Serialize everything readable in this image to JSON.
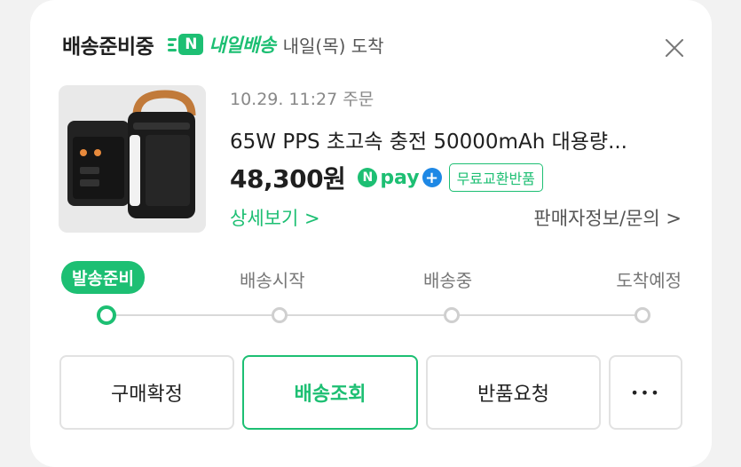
{
  "header": {
    "status_title": "배송준비중",
    "badge_letter": "N",
    "badge_text": "내일배송",
    "arrival_text": "내일(목) 도착"
  },
  "product": {
    "order_date": "10.29. 11:27 주문",
    "name": "65W PPS 초고속 충전 50000mAh 대용량...",
    "price": "48,300원",
    "npay_letter": "N",
    "npay_text": "pay",
    "npay_plus": "+",
    "free_return_badge": "무료교환반품",
    "detail_link": "상세보기 >",
    "seller_link": "판매자정보/문의 >"
  },
  "tracking": {
    "steps": [
      "발송준비",
      "배송시작",
      "배송중",
      "도착예정"
    ],
    "active_step": 0
  },
  "actions": {
    "confirm_purchase": "구매확정",
    "track_delivery": "배송조회",
    "request_return": "반품요청",
    "more": "•••"
  },
  "colors": {
    "accent": "#1dbf73",
    "npay_plus": "#1e88e5"
  },
  "icons": [
    "close-icon",
    "n-delivery-icon",
    "npay-icon",
    "more-icon"
  ]
}
